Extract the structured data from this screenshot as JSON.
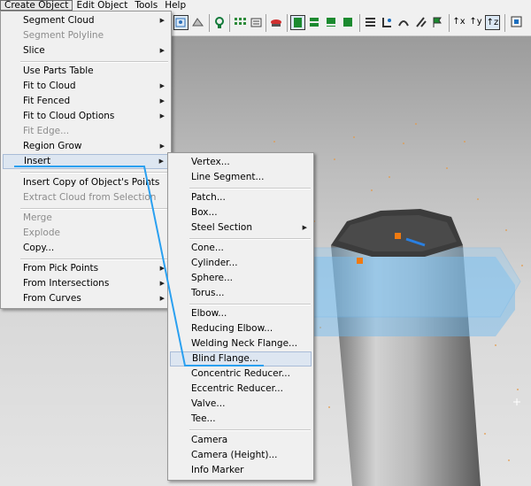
{
  "menubar": {
    "items": [
      "Create Object",
      "Edit Object",
      "Tools",
      "Help"
    ]
  },
  "create_menu": {
    "items": [
      {
        "label": "Segment Cloud",
        "submenu": true
      },
      {
        "label": "Segment Polyline",
        "disabled": true
      },
      {
        "label": "Slice",
        "submenu": true
      },
      {
        "label": "Use Parts Table"
      },
      {
        "label": "Fit to Cloud",
        "submenu": true
      },
      {
        "label": "Fit Fenced",
        "submenu": true
      },
      {
        "label": "Fit to Cloud Options",
        "submenu": true
      },
      {
        "label": "Fit Edge...",
        "disabled": true
      },
      {
        "label": "Region Grow",
        "submenu": true
      },
      {
        "label": "Insert",
        "submenu": true,
        "highlighted": true
      },
      {
        "label": "Insert Copy of Object's Points"
      },
      {
        "label": "Extract Cloud from Selection",
        "disabled": true
      },
      {
        "label": "Merge",
        "disabled": true
      },
      {
        "label": "Explode",
        "disabled": true
      },
      {
        "label": "Copy..."
      },
      {
        "label": "From Pick Points",
        "submenu": true
      },
      {
        "label": "From Intersections",
        "submenu": true
      },
      {
        "label": "From Curves",
        "submenu": true
      }
    ]
  },
  "insert_menu": {
    "items": [
      {
        "label": "Vertex..."
      },
      {
        "label": "Line Segment..."
      },
      {
        "label": "Patch..."
      },
      {
        "label": "Box..."
      },
      {
        "label": "Steel Section",
        "submenu": true
      },
      {
        "label": "Cone..."
      },
      {
        "label": "Cylinder..."
      },
      {
        "label": "Sphere..."
      },
      {
        "label": "Torus..."
      },
      {
        "label": "Elbow..."
      },
      {
        "label": "Reducing Elbow..."
      },
      {
        "label": "Welding Neck Flange..."
      },
      {
        "label": "Blind Flange...",
        "highlighted": true
      },
      {
        "label": "Concentric Reducer..."
      },
      {
        "label": "Eccentric Reducer..."
      },
      {
        "label": "Valve..."
      },
      {
        "label": "Tee..."
      },
      {
        "label": "Camera"
      },
      {
        "label": "Camera (Height)..."
      },
      {
        "label": "Info Marker"
      }
    ]
  },
  "toolbar": {
    "icons": [
      "select-mode-icon",
      "view-icon",
      "zoom-icon",
      "grid-icon",
      "layer-icon",
      "render-icon",
      "fit-icon",
      "line-icon",
      "layers-icon",
      "measure-icon",
      "cut-icon",
      "align-icon",
      "snap-icon",
      "view-options-icon",
      "axis-x-icon",
      "axis-y-icon",
      "axis-z-icon"
    ],
    "axis_labels": [
      "↑x",
      "↑y",
      "↑z"
    ]
  },
  "colors": {
    "menu_bg": "#f0f0f0",
    "highlight_bg": "#dde6f1",
    "trace": "#2aa0f0",
    "flange": "#6ab7f0",
    "marker": "#f07a10"
  }
}
